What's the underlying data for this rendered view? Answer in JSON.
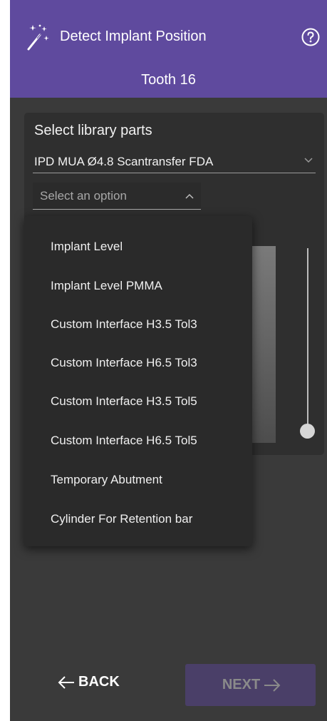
{
  "header": {
    "title": "Detect Implant Position",
    "subtitle": "Tooth 16",
    "accent_color": "#5f4a9e",
    "icons": {
      "wizard": "magic-wand-icon",
      "help": "help-circle-icon"
    }
  },
  "library": {
    "label": "Select library parts",
    "selected": "IPD MUA Ø4.8 Scantransfer FDA",
    "option_placeholder": "Select an option",
    "options": [
      "Implant Level",
      "Implant Level PMMA",
      "Custom Interface H3.5 Tol3",
      "Custom Interface H6.5 Tol3",
      "Custom Interface H3.5 Tol5",
      "Custom Interface H6.5 Tol5",
      "Temporary Abutment",
      "Cylinder For Retention bar"
    ]
  },
  "footer": {
    "back_label": "BACK",
    "next_label": "NEXT",
    "next_disabled": true
  }
}
